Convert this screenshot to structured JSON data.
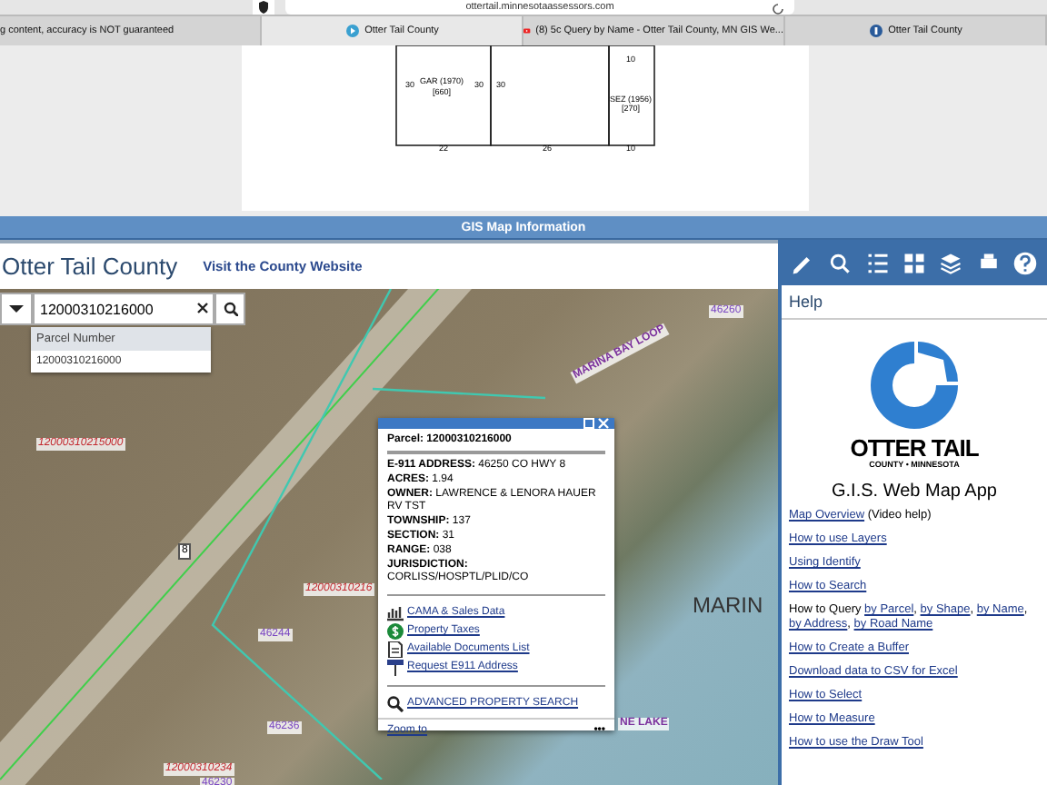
{
  "browser": {
    "address": "ottertail.minnesotaassessors.com",
    "tabs": [
      {
        "title": "g content, accuracy is NOT guaranteed",
        "kind": "plain",
        "selected": false
      },
      {
        "title": "Otter Tail County",
        "kind": "play",
        "selected": true
      },
      {
        "title": "(8) 5c Query by Name - Otter Tail County, MN GIS We...",
        "kind": "video",
        "selected": false
      },
      {
        "title": "Otter Tail County",
        "kind": "county",
        "selected": false
      }
    ]
  },
  "sketch": {
    "labels": [
      "30",
      "GAR (1970)",
      "[660]",
      "30",
      "30",
      "22",
      "26",
      "10",
      "SEZ (1956)",
      "[270]",
      "10"
    ]
  },
  "info_bar": {
    "title": "GIS Map Information"
  },
  "header": {
    "title": "Otter Tail County",
    "link": "Visit the County Website"
  },
  "search": {
    "value": "12000310216000",
    "suggest_header": "Parcel Number",
    "suggestions": [
      "12000310216000"
    ]
  },
  "map": {
    "labels": [
      {
        "text": "12000310215000",
        "kind": "parcel"
      },
      {
        "text": "12000310216",
        "kind": "parcel"
      },
      {
        "text": "46244",
        "kind": "address"
      },
      {
        "text": "46236",
        "kind": "address"
      },
      {
        "text": "12000310234",
        "kind": "parcel"
      },
      {
        "text": "46230",
        "kind": "address"
      },
      {
        "text": "8",
        "kind": "shield"
      },
      {
        "text": "MARINA BAY LOOP",
        "kind": "road"
      },
      {
        "text": "46260",
        "kind": "address"
      },
      {
        "text": "MARIN",
        "kind": "water"
      },
      {
        "text": "NE LAKE",
        "kind": "road"
      }
    ]
  },
  "popup": {
    "title": "Parcel: 12000310216000",
    "fields": [
      {
        "label": "E-911 ADDRESS:",
        "value": "46250 CO HWY 8"
      },
      {
        "label": "ACRES:",
        "value": "1.94"
      },
      {
        "label": "OWNER:",
        "value": "LAWRENCE & LENORA HAUER RV TST"
      },
      {
        "label": "TOWNSHIP:",
        "value": "137"
      },
      {
        "label": "SECTION:",
        "value": "31"
      },
      {
        "label": "RANGE:",
        "value": "038"
      },
      {
        "label": "JURISDICTION:",
        "value": "CORLISS/HOSPTL/PLID/CO"
      }
    ],
    "links": [
      {
        "text": "CAMA & Sales Data",
        "kind": "chart"
      },
      {
        "text": "Property Taxes",
        "kind": "dollar"
      },
      {
        "text": "Available Documents List",
        "kind": "document"
      },
      {
        "text": "Request E911 Address",
        "kind": "sign"
      }
    ],
    "search_link": "ADVANCED PROPERTY SEARCH",
    "zoom": "Zoom to",
    "more": "•••"
  },
  "toolbar": {
    "tools": [
      {
        "kind": "pencil"
      },
      {
        "kind": "search"
      },
      {
        "kind": "list"
      },
      {
        "kind": "grid"
      },
      {
        "kind": "layers"
      },
      {
        "kind": "print"
      },
      {
        "kind": "help"
      }
    ]
  },
  "help": {
    "title": "Help",
    "logo_name": "OTTER TAIL",
    "logo_sub": "COUNTY • MINNESOTA",
    "app_title": "G.I.S. Web Map App",
    "items": [
      [
        {
          "text": "Map Overview",
          "link": true
        },
        {
          "text": " (Video help)",
          "link": false
        }
      ],
      [
        {
          "text": "How to use Layers",
          "link": true
        }
      ],
      [
        {
          "text": "Using Identify",
          "link": true
        }
      ],
      [
        {
          "text": "How to Search",
          "link": true
        }
      ],
      [
        {
          "text": "How to Query ",
          "link": false
        },
        {
          "text": "by Parcel",
          "link": true
        },
        {
          "text": ", ",
          "link": false
        },
        {
          "text": "by Shape",
          "link": true
        },
        {
          "text": ", ",
          "link": false
        },
        {
          "text": "by Name",
          "link": true
        },
        {
          "text": ", ",
          "link": false
        },
        {
          "text": "by Address",
          "link": true
        },
        {
          "text": ", ",
          "link": false
        },
        {
          "text": "by Road Name",
          "link": true
        }
      ],
      [
        {
          "text": "How to Create a Buffer",
          "link": true
        }
      ],
      [
        {
          "text": "Download data to CSV for Excel",
          "link": true
        }
      ],
      [
        {
          "text": "How to Select",
          "link": true
        }
      ],
      [
        {
          "text": "How to Measure",
          "link": true
        }
      ],
      [
        {
          "text": "How to use the Draw Tool",
          "link": true
        }
      ]
    ]
  }
}
